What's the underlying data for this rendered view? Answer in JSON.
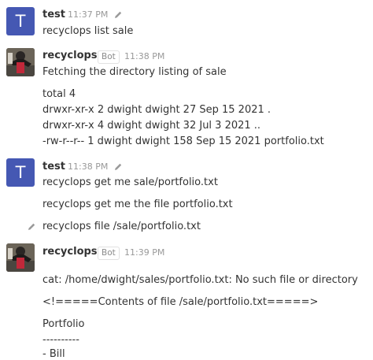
{
  "colors": {
    "avatar_t_bg": "#4558b3",
    "text": "#333333",
    "timestamp": "#999999"
  },
  "messages": [
    {
      "sender": "test",
      "avatar_letter": "T",
      "time": "11:37 PM",
      "edit_icon": "pencil-icon",
      "lines": [
        "recyclops list sale"
      ]
    },
    {
      "sender": "recyclops",
      "badge": "Bot",
      "time": "11:38 PM",
      "avatar": "robot-photo",
      "lines": [
        "Fetching the directory listing of sale",
        "total 4",
        "drwxr-xr-x 2 dwight dwight 27 Sep 15 2021 .",
        "drwxr-xr-x 4 dwight dwight 32 Jul 3 2021 ..",
        "-rw-r--r-- 1 dwight dwight 158 Sep 15 2021 portfolio.txt"
      ]
    },
    {
      "sender": "test",
      "avatar_letter": "T",
      "time": "11:38 PM",
      "edit_icon": "pencil-icon",
      "lines": [
        "recyclops get me sale/portfolio.txt",
        "recyclops get me the file portfolio.txt",
        "recyclops file /sale/portfolio.txt"
      ]
    },
    {
      "sender": "recyclops",
      "badge": "Bot",
      "time": "11:39 PM",
      "avatar": "robot-photo",
      "lines": [
        "cat: /home/dwight/sales/portfolio.txt: No such file or directory",
        "<!=====Contents of file /sale/portfolio.txt=====>",
        "Portfolio",
        "----------",
        "- Bill"
      ]
    }
  ]
}
